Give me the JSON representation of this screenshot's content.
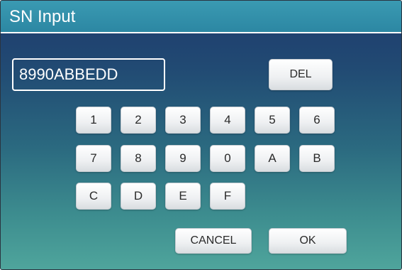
{
  "window": {
    "title": "SN Input"
  },
  "display": {
    "value": "8990ABBEDD"
  },
  "buttons": {
    "del": "DEL",
    "cancel": "CANCEL",
    "ok": "OK"
  },
  "keypad": {
    "rows": [
      [
        "1",
        "2",
        "3",
        "4",
        "5",
        "6"
      ],
      [
        "7",
        "8",
        "9",
        "0",
        "A",
        "B"
      ],
      [
        "C",
        "D",
        "E",
        "F"
      ]
    ]
  },
  "colors": {
    "titlebar": "#2c87a3",
    "background_top": "#1f3a6d",
    "background_bottom": "#4fa59c",
    "button_face": "#eef0f2"
  }
}
